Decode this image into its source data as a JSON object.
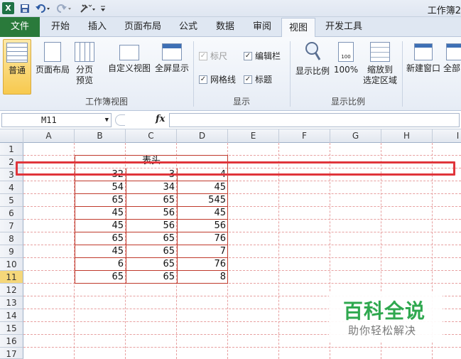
{
  "titlebar": {
    "app_icon": "X",
    "title": "工作簿2",
    "undo_icon": "undo-icon",
    "redo_icon": "redo-icon",
    "save_icon": "save-icon",
    "customize_icon": "customize-icon"
  },
  "tabs": [
    {
      "label": "文件"
    },
    {
      "label": "开始"
    },
    {
      "label": "插入"
    },
    {
      "label": "页面布局"
    },
    {
      "label": "公式"
    },
    {
      "label": "数据"
    },
    {
      "label": "审阅"
    },
    {
      "label": "视图"
    },
    {
      "label": "开发工具"
    }
  ],
  "ribbon": {
    "workbook_views": {
      "group_label": "工作簿视图",
      "normal": "普通",
      "page_layout": "页面布局",
      "page_break_line1": "分页",
      "page_break_line2": "预览",
      "custom_view": "自定义视图",
      "full_screen": "全屏显示"
    },
    "show": {
      "group_label": "显示",
      "ruler": "标尺",
      "formula_bar": "编辑栏",
      "gridlines": "网格线",
      "headings": "标题"
    },
    "zoom": {
      "group_label": "显示比例",
      "zoom": "显示比例",
      "hundred": "100%",
      "zoom_to_selection_line1": "缩放到",
      "zoom_to_selection_line2": "选定区域"
    },
    "window": {
      "new_window": "新建窗口",
      "arrange_all": "全部"
    }
  },
  "formula_bar": {
    "name_box": "M11",
    "fx": "fx",
    "formula": ""
  },
  "columns": [
    "A",
    "B",
    "C",
    "D",
    "E",
    "F",
    "G",
    "H",
    "I"
  ],
  "rows": [
    "1",
    "2",
    "3",
    "4",
    "5",
    "6",
    "7",
    "8",
    "9",
    "10",
    "11",
    "12",
    "13",
    "14",
    "15",
    "16",
    "17"
  ],
  "table": {
    "header": "表头",
    "data": [
      [
        "32",
        "3",
        "4"
      ],
      [
        "54",
        "34",
        "45"
      ],
      [
        "65",
        "65",
        "545"
      ],
      [
        "45",
        "56",
        "45"
      ],
      [
        "45",
        "56",
        "56"
      ],
      [
        "65",
        "65",
        "76"
      ],
      [
        "45",
        "65",
        "7"
      ],
      [
        "6",
        "65",
        "76"
      ],
      [
        "65",
        "65",
        "8"
      ]
    ]
  },
  "watermark": {
    "title": "百科全说",
    "subtitle": "助你轻松解决"
  }
}
